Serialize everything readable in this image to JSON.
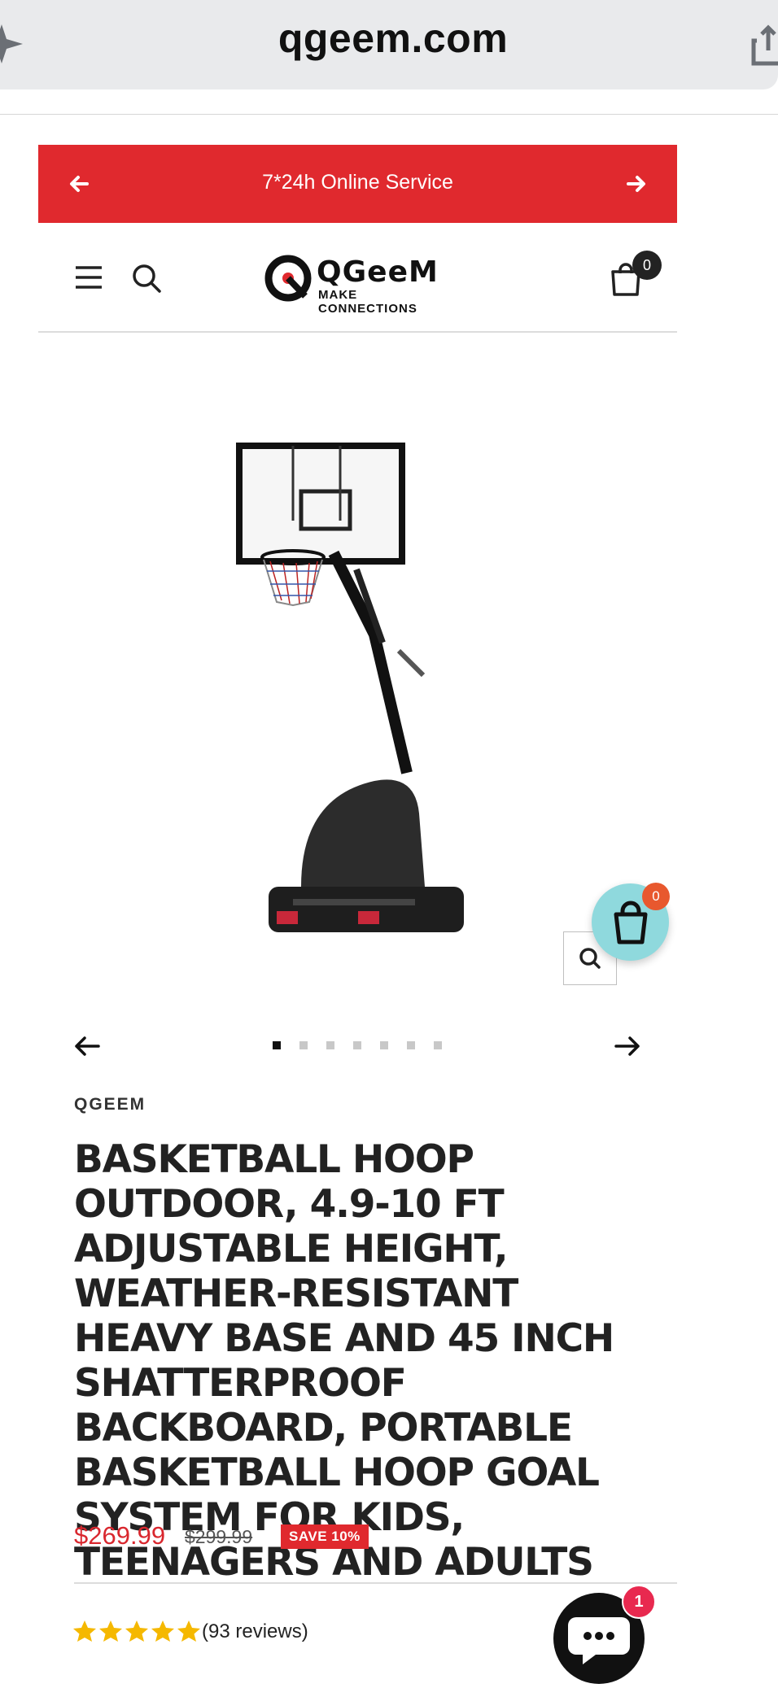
{
  "browser": {
    "url": "qgeem.com"
  },
  "announcement": {
    "text": "7*24h Online Service"
  },
  "header": {
    "logo_text": "QGeeM",
    "logo_tagline": "MAKE CONNECTIONS",
    "cart_count": "0"
  },
  "floating_cart": {
    "count": "0"
  },
  "carousel": {
    "total_slides": 7,
    "active_index": 0
  },
  "product": {
    "vendor": "QGEEM",
    "title": "BASKETBALL HOOP OUTDOOR, 4.9-10 FT ADJUSTABLE HEIGHT, WEATHER-RESISTANT HEAVY BASE AND 45 INCH SHATTERPROOF BACKBOARD, PORTABLE BASKETBALL HOOP GOAL SYSTEM FOR KIDS, TEENAGERS AND ADULTS",
    "price": "$269.99",
    "compare_price": "$299.99",
    "save_badge": "SAVE 10%",
    "rating": 5,
    "reviews_text": "(93 reviews)"
  },
  "chat": {
    "unread": "1"
  },
  "colors": {
    "accent": "#e0292e",
    "price": "#d9272e",
    "float_cart": "#8fd9dd",
    "star": "#f5b800"
  }
}
